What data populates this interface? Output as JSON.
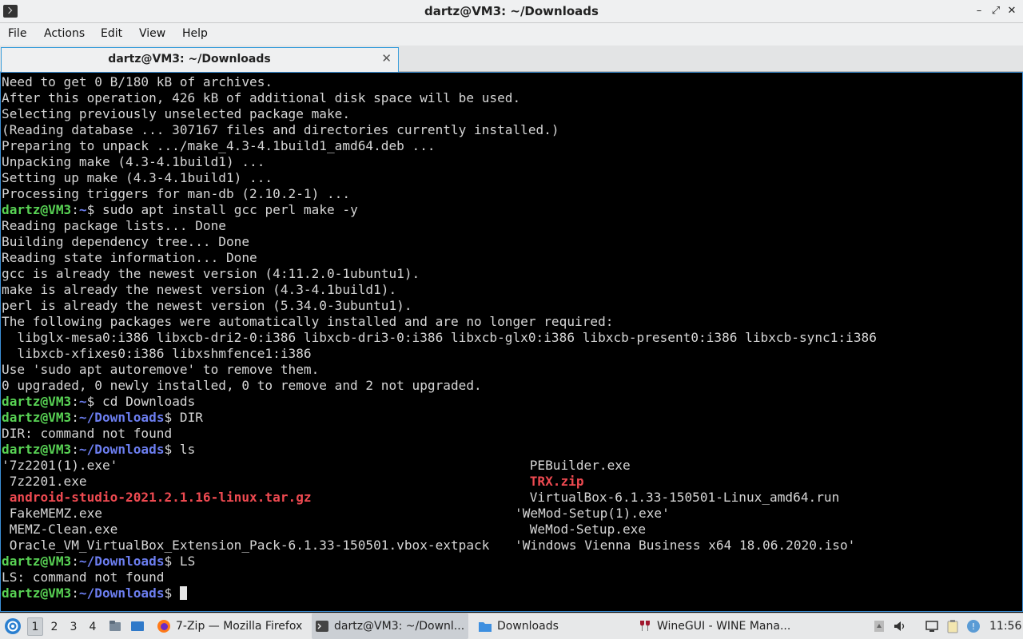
{
  "window": {
    "title": "dartz@VM3: ~/Downloads"
  },
  "menu": [
    "File",
    "Actions",
    "Edit",
    "View",
    "Help"
  ],
  "tab": {
    "label": "dartz@VM3: ~/Downloads"
  },
  "prompt": {
    "userhost": "dartz@VM3",
    "sep": ":",
    "home": "~",
    "downloads": "~/Downloads",
    "sigil": "$ "
  },
  "terminal": {
    "top_lines": [
      "Need to get 0 B/180 kB of archives.",
      "After this operation, 426 kB of additional disk space will be used.",
      "Selecting previously unselected package make.",
      "(Reading database ... 307167 files and directories currently installed.)",
      "Preparing to unpack .../make_4.3-4.1build1_amd64.deb ...",
      "Unpacking make (4.3-4.1build1) ...",
      "Setting up make (4.3-4.1build1) ...",
      "Processing triggers for man-db (2.10.2-1) ..."
    ],
    "cmd1": "sudo apt install gcc perl make -y",
    "apt_lines": [
      "Reading package lists... Done",
      "Building dependency tree... Done",
      "Reading state information... Done",
      "gcc is already the newest version (4:11.2.0-1ubuntu1).",
      "make is already the newest version (4.3-4.1build1).",
      "perl is already the newest version (5.34.0-3ubuntu1).",
      "The following packages were automatically installed and are no longer required:",
      "  libglx-mesa0:i386 libxcb-dri2-0:i386 libxcb-dri3-0:i386 libxcb-glx0:i386 libxcb-present0:i386 libxcb-sync1:i386",
      "  libxcb-xfixes0:i386 libxshmfence1:i386",
      "Use 'sudo apt autoremove' to remove them.",
      "0 upgraded, 0 newly installed, 0 to remove and 2 not upgraded."
    ],
    "cmd2": "cd Downloads",
    "cmd3": "DIR",
    "out3": "DIR: command not found",
    "cmd4": "ls",
    "ls_col1": [
      "'7z2201(1).exe'",
      " 7z2201.exe",
      " android-studio-2021.2.1.16-linux.tar.gz",
      " FakeMEMZ.exe",
      " MEMZ-Clean.exe",
      " Oracle_VM_VirtualBox_Extension_Pack-6.1.33-150501.vbox-extpack"
    ],
    "ls_col2": [
      " PEBuilder.exe",
      " TRX.zip",
      " VirtualBox-6.1.33-150501-Linux_amd64.run",
      "'WeMod-Setup(1).exe'",
      " WeMod-Setup.exe",
      "'Windows Vienna Business x64 18.06.2020.iso'"
    ],
    "cmd5": "LS",
    "out5": "LS: command not found"
  },
  "taskbar": {
    "workspaces": [
      "1",
      "2",
      "3",
      "4"
    ],
    "tasks": [
      {
        "label": "7-Zip — Mozilla Firefox",
        "icon": "firefox-icon"
      },
      {
        "label": "dartz@VM3: ~/Downl...",
        "icon": "terminal-icon"
      },
      {
        "label": "Downloads",
        "icon": "folder-icon"
      },
      {
        "label": "WineGUI - WINE Mana...",
        "icon": "wine-icon"
      }
    ],
    "clock": "11:56"
  },
  "colors": {
    "prompt_user": "#58d254",
    "prompt_path": "#6c7ef0",
    "archive": "#ef4a51",
    "accent": "#3b8fd6"
  }
}
